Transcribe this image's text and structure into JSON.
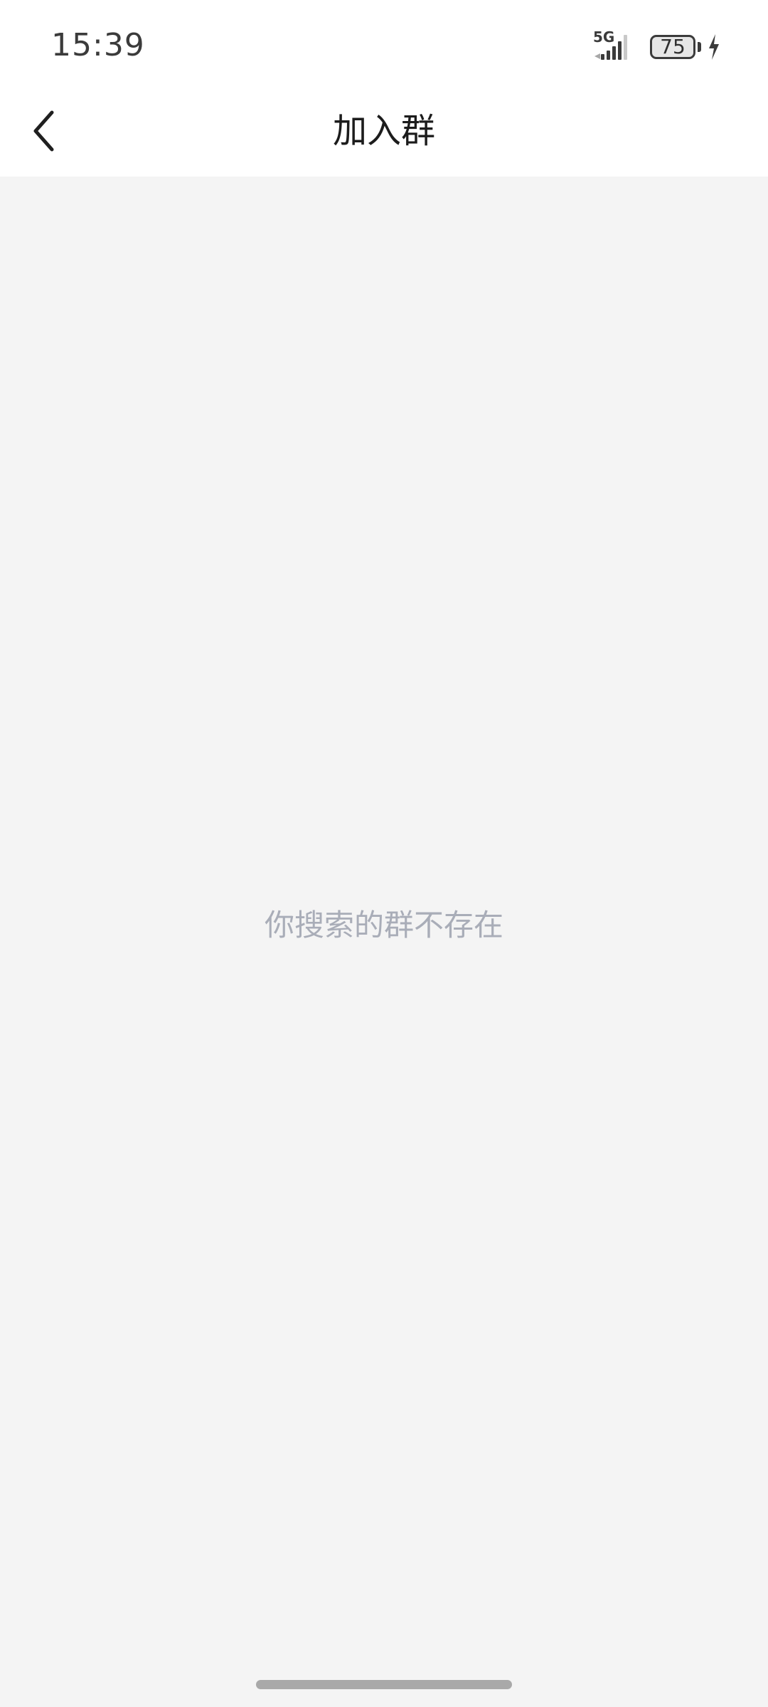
{
  "status_bar": {
    "time": "15:39",
    "network": "5G",
    "battery": "75",
    "icons": [
      "signal-icon",
      "battery-icon",
      "charging-icon"
    ]
  },
  "header": {
    "title": "加入群",
    "back_icon": "chevron-left-icon"
  },
  "content": {
    "empty_message": "你搜索的群不存在"
  },
  "colors": {
    "background": "#f4f4f4",
    "header_background": "#ffffff",
    "title_text": "#1c1c1c",
    "empty_text": "#a9adb8"
  }
}
